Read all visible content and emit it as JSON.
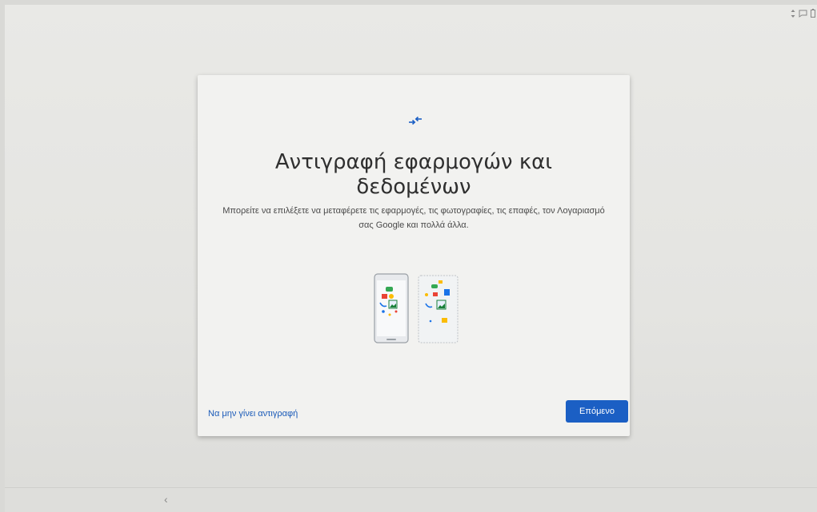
{
  "status_bar": {
    "icons": [
      "data-transfer-icon",
      "chat-icon",
      "battery-icon"
    ]
  },
  "dialog": {
    "icon": "transfer-arrows-icon",
    "title": "Αντιγραφή εφαρμογών και δεδομένων",
    "description": "Μπορείτε να επιλέξετε να μεταφέρετε τις εφαρμογές, τις φωτογραφίες, τις επαφές, τον Λογαριασμό σας Google και πολλά άλλα.",
    "illustration": "phone-to-tablet-transfer-illustration",
    "skip_label": "Να μην γίνει αντιγραφή",
    "next_label": "Επόμενο"
  },
  "nav_bar": {
    "back_label": "‹"
  },
  "colors": {
    "accent": "#1b5fc4",
    "link": "#1a5ab8"
  }
}
